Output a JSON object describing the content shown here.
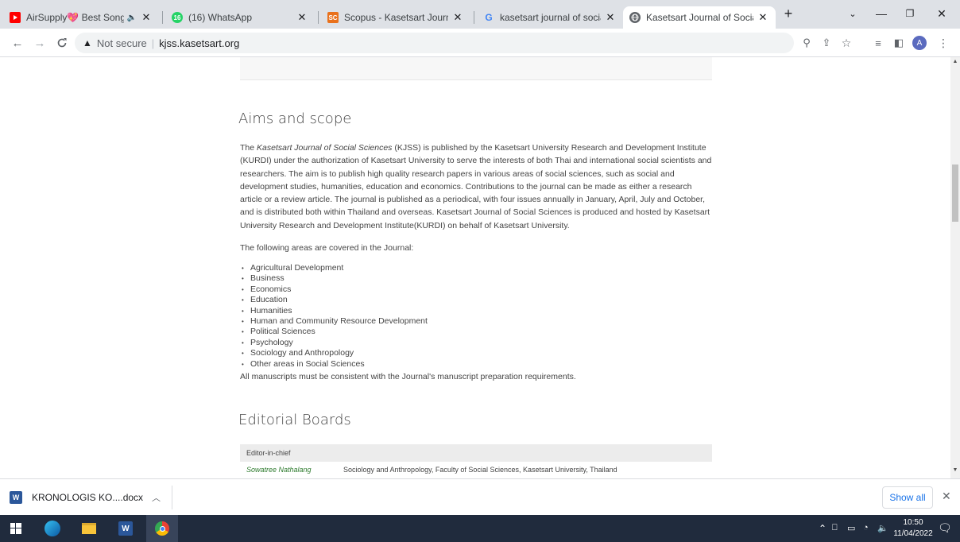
{
  "tabs": [
    {
      "title": "AirSupply💖 Best Songs",
      "favicon": "youtube-icon",
      "audio": true
    },
    {
      "title": "(16) WhatsApp",
      "favicon": "whatsapp-icon",
      "badge": "16"
    },
    {
      "title": "Scopus - Kasetsart Journal - S",
      "favicon": "scopus-icon",
      "fav_text": "SC"
    },
    {
      "title": "kasetsart journal of social sci",
      "favicon": "google-icon",
      "fav_text": "G"
    },
    {
      "title": "Kasetsart Journal of Social Sc",
      "favicon": "globe-icon",
      "active": true
    }
  ],
  "address": {
    "security_label": "Not secure",
    "url": "kjss.kasetsart.org"
  },
  "page": {
    "aims_title": "Aims and scope",
    "aims_p1_pre": "The ",
    "aims_p1_em": "Kasetsart Journal of Social Sciences",
    "aims_p1_rest": " (KJSS) is published by the Kasetsart University Research and Development Institute (KURDI) under the authorization of Kasetsart University to serve the interests of both Thai and international social scientists and researchers. The aim is to publish high quality research papers in various areas of social sciences, such as social and development studies, humanities, education and economics. Contributions to the journal can be made as either a research article or a review article. The journal is published as a periodical, with four issues annually in January, April, July and October, and is distributed both within Thailand and overseas. Kasetsart Journal of Social Sciences is produced and hosted by Kasetsart University Research and Development Institute(KURDI) on behalf of Kasetsart University.",
    "areas_intro": "The following areas are covered in the Journal:",
    "areas": [
      "Agricultural Development",
      "Business",
      "Economics",
      "Education",
      "Humanities",
      "Human and Community Resource Development",
      "Political Sciences",
      "Psychology",
      "Sociology and Anthropology",
      "Other areas in Social Sciences"
    ],
    "manuscripts_note": "All manuscripts must be consistent with the Journal's manuscript preparation requirements.",
    "editorial_title": "Editorial Boards",
    "board_header": "Editor-in-chief",
    "editor_name": "Sowatree Nathalang",
    "editor_affiliation": "Sociology and Anthropology, Faculty of Social Sciences, Kasetsart University, Thailand"
  },
  "download": {
    "filename": "KRONOLOGIS KO....docx",
    "show_all": "Show all"
  },
  "taskbar": {
    "time": "10:50",
    "date": "11/04/2022",
    "notification_count": "1"
  },
  "colors": {
    "tabstrip": "#dee1e6",
    "taskbar": "#202b3d",
    "link": "#2d7a2d",
    "accent": "#1a73e8"
  }
}
